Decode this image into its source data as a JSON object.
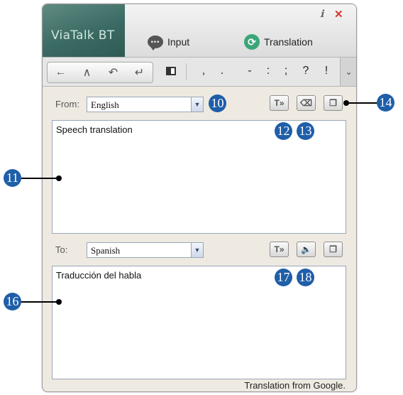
{
  "window": {
    "logo": "ViaTalk BT",
    "help_icon": "help-icon",
    "close_icon": "close-icon"
  },
  "tabs": [
    {
      "label": "Input",
      "icon": "chat-bubble-icon"
    },
    {
      "label": "Translation",
      "icon": "refresh-icon"
    }
  ],
  "toolbar": {
    "nav_icons": [
      "left-arrow-icon",
      "caret-up-icon",
      "undo-icon",
      "enter-icon"
    ],
    "layout_icon": "layout-toggle-icon",
    "punctuation": [
      ",",
      ".",
      "-",
      ":",
      ";",
      "?",
      "!"
    ],
    "dropdown_icon": "chevron-down-icon"
  },
  "source": {
    "label": "From:",
    "language": "English",
    "text": "Speech translation",
    "buttons": [
      "translate-icon",
      "eraser-icon",
      "copy-icon"
    ]
  },
  "target": {
    "label": "To:",
    "language": "Spanish",
    "text": "Traducción del habla",
    "buttons": [
      "translate-icon",
      "speaker-icon",
      "copy-icon"
    ]
  },
  "footer": "Translation from Google.",
  "callouts": {
    "c10": "10",
    "c11": "11",
    "c12": "12",
    "c13": "13",
    "c14": "14",
    "c16": "16",
    "c17": "17",
    "c18": "18"
  },
  "colors": {
    "callout": "#1f5ea8",
    "logo_bg": "#3b6b64",
    "close": "#d23a2e"
  }
}
